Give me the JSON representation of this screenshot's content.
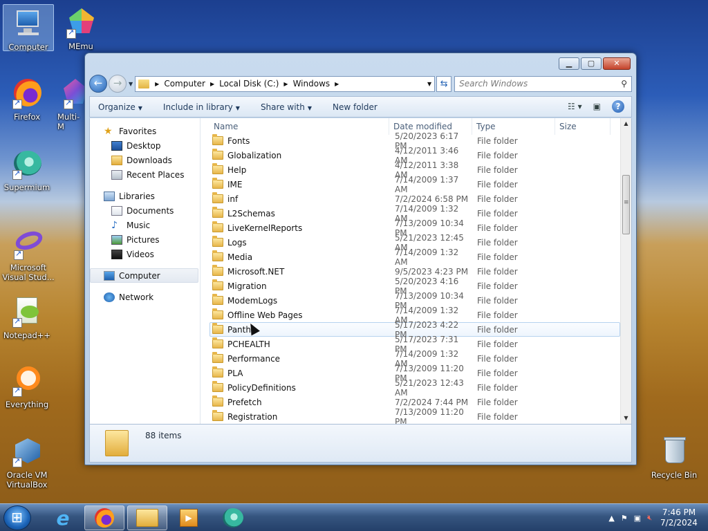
{
  "desktop": {
    "icons": [
      {
        "label": "Computer"
      },
      {
        "label": "MEmu"
      },
      {
        "label": "Firefox"
      },
      {
        "label": "Multi-M"
      },
      {
        "label": "Supermium"
      },
      {
        "label": "Microsoft Visual Stud..."
      },
      {
        "label": "Notepad++"
      },
      {
        "label": "Everything"
      },
      {
        "label": "Oracle VM VirtualBox"
      },
      {
        "label": "Recycle Bin"
      }
    ]
  },
  "window": {
    "address": {
      "crumbs": [
        "Computer",
        "Local Disk (C:)",
        "Windows"
      ]
    },
    "search_placeholder": "Search Windows",
    "toolbar": {
      "organize": "Organize",
      "include": "Include in library",
      "share": "Share with",
      "new_folder": "New folder"
    },
    "nav": {
      "favorites": "Favorites",
      "desktop": "Desktop",
      "downloads": "Downloads",
      "recent": "Recent Places",
      "libraries": "Libraries",
      "documents": "Documents",
      "music": "Music",
      "pictures": "Pictures",
      "videos": "Videos",
      "computer": "Computer",
      "network": "Network"
    },
    "columns": {
      "name": "Name",
      "date": "Date modified",
      "type": "Type",
      "size": "Size"
    },
    "rows": [
      {
        "name": "Fonts",
        "date": "5/20/2023 6:17 PM",
        "type": "File folder"
      },
      {
        "name": "Globalization",
        "date": "4/12/2011 3:46 AM",
        "type": "File folder"
      },
      {
        "name": "Help",
        "date": "4/12/2011 3:38 AM",
        "type": "File folder"
      },
      {
        "name": "IME",
        "date": "7/14/2009 1:37 AM",
        "type": "File folder"
      },
      {
        "name": "inf",
        "date": "7/2/2024 6:58 PM",
        "type": "File folder"
      },
      {
        "name": "L2Schemas",
        "date": "7/14/2009 1:32 AM",
        "type": "File folder"
      },
      {
        "name": "LiveKernelReports",
        "date": "7/13/2009 10:34 PM",
        "type": "File folder"
      },
      {
        "name": "Logs",
        "date": "5/21/2023 12:45 AM",
        "type": "File folder"
      },
      {
        "name": "Media",
        "date": "7/14/2009 1:32 AM",
        "type": "File folder"
      },
      {
        "name": "Microsoft.NET",
        "date": "9/5/2023 4:23 PM",
        "type": "File folder"
      },
      {
        "name": "Migration",
        "date": "5/20/2023 4:16 PM",
        "type": "File folder"
      },
      {
        "name": "ModemLogs",
        "date": "7/13/2009 10:34 PM",
        "type": "File folder"
      },
      {
        "name": "Offline Web Pages",
        "date": "7/14/2009 1:32 AM",
        "type": "File folder"
      },
      {
        "name": "Panth",
        "date": "5/17/2023 4:22 PM",
        "type": "File folder"
      },
      {
        "name": "PCHEALTH",
        "date": "5/17/2023 7:31 PM",
        "type": "File folder"
      },
      {
        "name": "Performance",
        "date": "7/14/2009 1:32 AM",
        "type": "File folder"
      },
      {
        "name": "PLA",
        "date": "7/13/2009 11:20 PM",
        "type": "File folder"
      },
      {
        "name": "PolicyDefinitions",
        "date": "5/21/2023 12:43 AM",
        "type": "File folder"
      },
      {
        "name": "Prefetch",
        "date": "7/2/2024 7:44 PM",
        "type": "File folder"
      },
      {
        "name": "Registration",
        "date": "7/13/2009 11:20 PM",
        "type": "File folder"
      }
    ],
    "status": "88 items"
  },
  "taskbar": {
    "time": "7:46 PM",
    "date": "7/2/2024"
  }
}
